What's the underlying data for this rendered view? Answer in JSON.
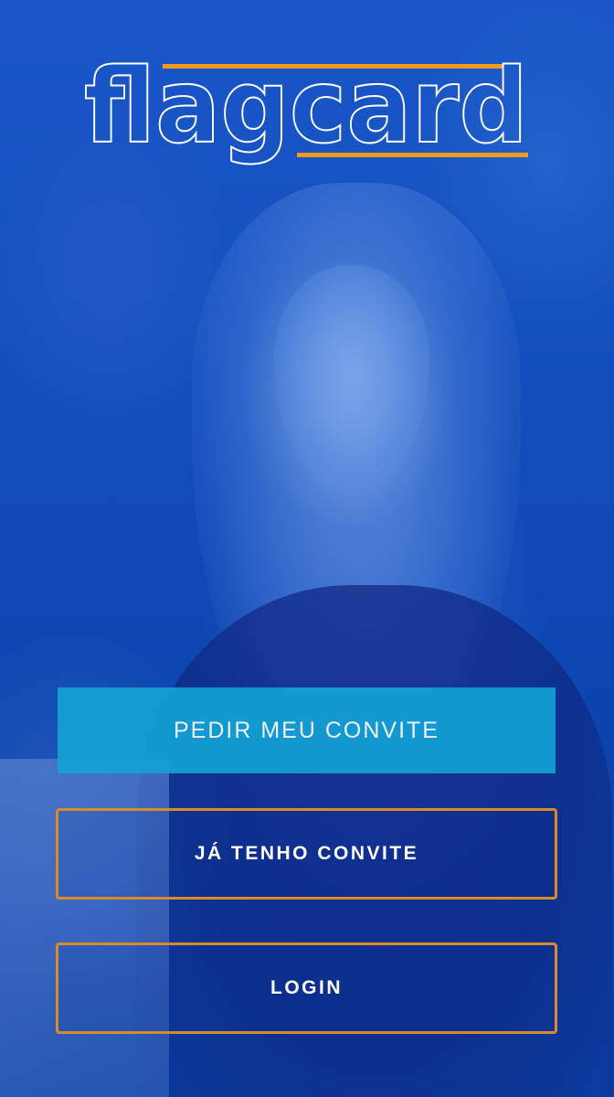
{
  "brand": {
    "name": "flagcard",
    "accent_color": "#f39a1e",
    "outline_color": "#ffffff"
  },
  "actions": {
    "request_invite_label": "PEDIR MEU CONVITE",
    "have_invite_label": "JÁ TENHO CONVITE",
    "login_label": "LOGIN"
  },
  "colors": {
    "background": "#0b3ea8",
    "primary_button": "#13a1d4",
    "outline_button_border": "#d98b2b"
  }
}
